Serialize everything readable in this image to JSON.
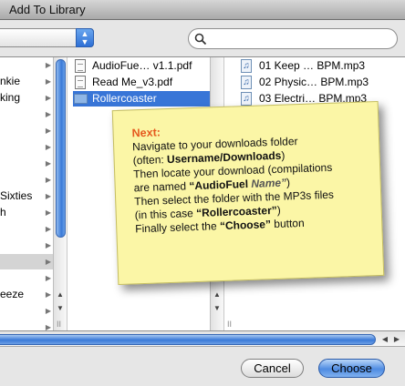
{
  "window": {
    "title": "Add To Library"
  },
  "search": {
    "placeholder": "",
    "value": ""
  },
  "location_popup": {
    "value": ""
  },
  "columns": {
    "col1": [
      {
        "label": "",
        "arrow": true,
        "state": ""
      },
      {
        "label": "nkie",
        "arrow": true,
        "state": ""
      },
      {
        "label": "king",
        "arrow": true,
        "state": ""
      },
      {
        "label": "",
        "arrow": true,
        "state": ""
      },
      {
        "label": "",
        "arrow": true,
        "state": ""
      },
      {
        "label": "",
        "arrow": true,
        "state": ""
      },
      {
        "label": "",
        "arrow": true,
        "state": ""
      },
      {
        "label": "",
        "arrow": true,
        "state": ""
      },
      {
        "label": "Sixties",
        "arrow": true,
        "state": ""
      },
      {
        "label": "h",
        "arrow": true,
        "state": ""
      },
      {
        "label": "",
        "arrow": true,
        "state": ""
      },
      {
        "label": "",
        "arrow": true,
        "state": ""
      },
      {
        "label": "",
        "arrow": true,
        "state": "grey"
      },
      {
        "label": "",
        "arrow": true,
        "state": ""
      },
      {
        "label": "eeze",
        "arrow": true,
        "state": ""
      },
      {
        "label": "",
        "arrow": true,
        "state": ""
      },
      {
        "label": "",
        "arrow": true,
        "state": ""
      }
    ],
    "col2": [
      {
        "label": "AudioFue… v1.1.pdf",
        "icon": "pdf-file-icon",
        "arrow": false
      },
      {
        "label": "Read Me_v3.pdf",
        "icon": "pdf-file-icon",
        "arrow": false
      },
      {
        "label": "Rollercoaster",
        "icon": "folder-icon",
        "arrow": true,
        "state": "blue"
      }
    ],
    "col3": [
      {
        "label": "01 Keep … BPM.mp3",
        "icon": "mp3-file-icon"
      },
      {
        "label": "02 Physic… BPM.mp3",
        "icon": "mp3-file-icon"
      },
      {
        "label": "03 Electri… BPM.mp3",
        "icon": "mp3-file-icon"
      }
    ]
  },
  "note": {
    "heading": "Next:",
    "line1": "Navigate to your downloads folder",
    "line2_prefix": "(often: ",
    "line2_bold": "Username/Downloads",
    "line2_suffix": ")",
    "line3": "Then locate your download (compilations",
    "line4_prefix": "are named ",
    "line4_bold": "“AudioFuel ",
    "line4_italic": "Name”",
    "line4_suffix": ")",
    "line5": "Then select the folder with the MP3s files",
    "line6_prefix": "(in this case ",
    "line6_bold": "“Rollercoaster”",
    "line6_suffix": ")",
    "line7_prefix": "Finally select the ",
    "line7_bold": "“Choose”",
    "line7_suffix": " button"
  },
  "buttons": {
    "cancel": "Cancel",
    "choose": "Choose"
  },
  "icons": {
    "popup_stepper": "up-down-chevron-icon",
    "search": "magnifier-icon",
    "row_arrow": "▶",
    "scroll_up": "▲",
    "scroll_down": "▼",
    "scroll_left": "◀",
    "scroll_right": "▶",
    "grip": "II"
  },
  "colors": {
    "selection": "#3875d7",
    "note_bg": "#fbf6a6",
    "note_heading": "#e55a1f",
    "accent": "#3a7ad8"
  }
}
